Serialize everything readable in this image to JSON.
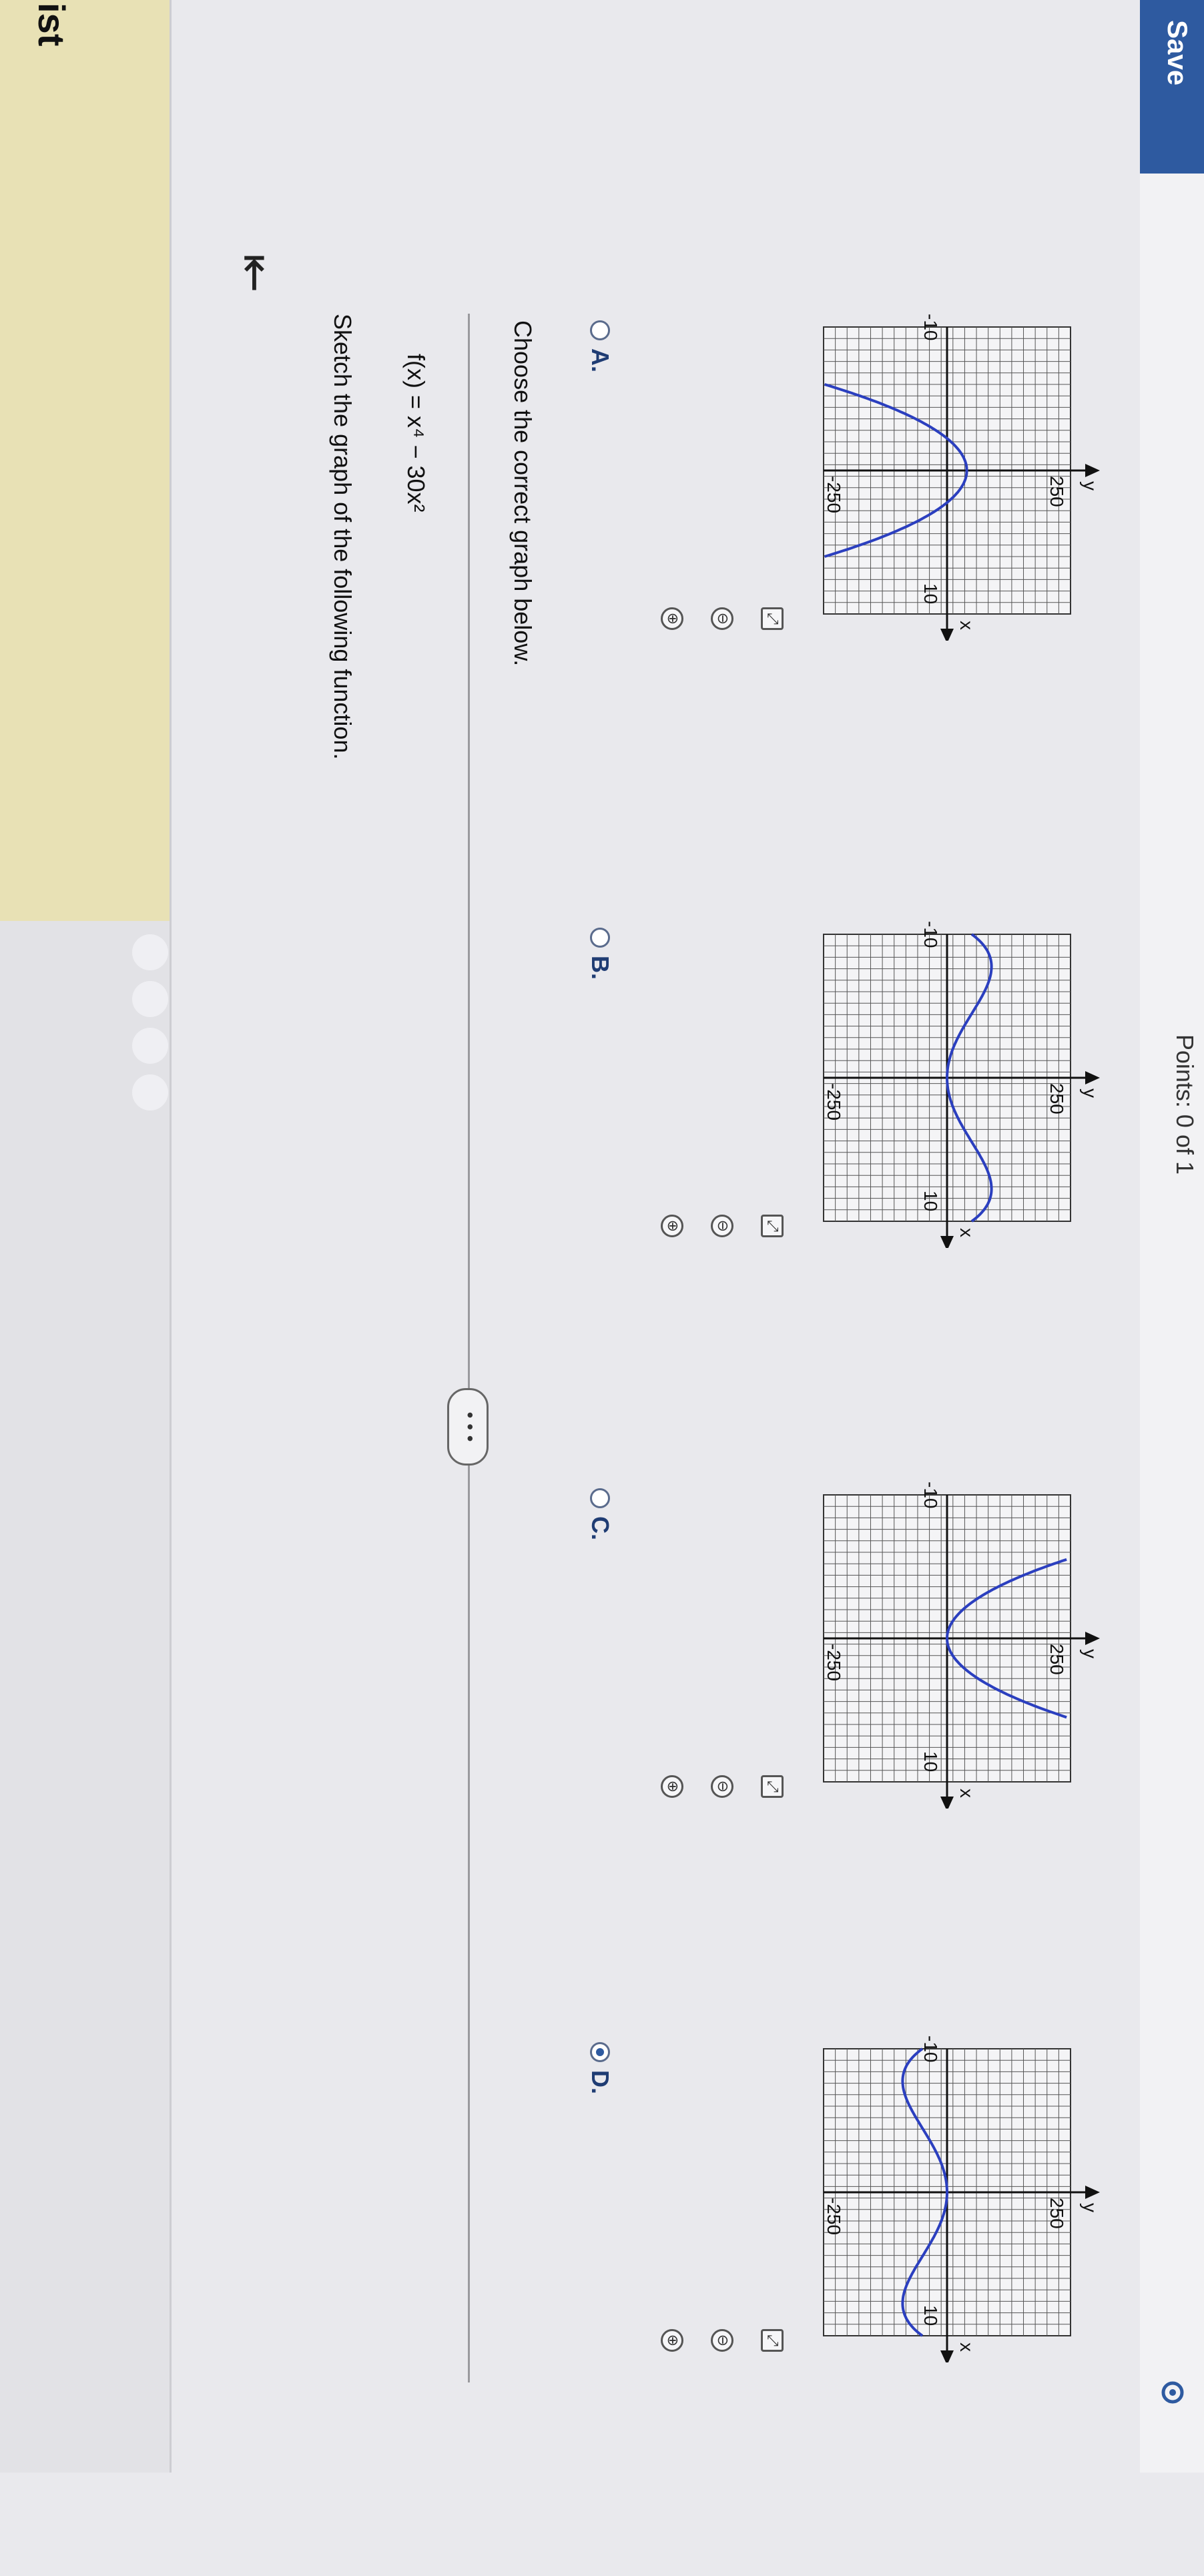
{
  "sidebar": {
    "title": "ist"
  },
  "header": {
    "save_label": "Save",
    "points": "Points: 0 of 1"
  },
  "question": {
    "prompt": "Sketch the graph of the following function.",
    "function": "f(x) = x⁴ − 30x²",
    "instruction": "Choose the correct graph below."
  },
  "more_label": "• • •",
  "options": [
    {
      "label": "A.",
      "selected": false,
      "variant": "narrow-bump"
    },
    {
      "label": "B.",
      "selected": false,
      "variant": "inverted-w"
    },
    {
      "label": "C.",
      "selected": false,
      "variant": "narrow-u"
    },
    {
      "label": "D.",
      "selected": true,
      "variant": "w-shape"
    }
  ],
  "graph_labels": {
    "y": "y",
    "x": "x",
    "ymax": "250",
    "ymin": "-250",
    "xmin": "-10",
    "xmax": "10"
  },
  "zoom_icons": [
    "zoom-in",
    "zoom-out",
    "fullscreen"
  ],
  "colors": {
    "curve": "#2b3fbf",
    "accent": "#2e5aa0",
    "highlight": "#e8e1b5"
  }
}
